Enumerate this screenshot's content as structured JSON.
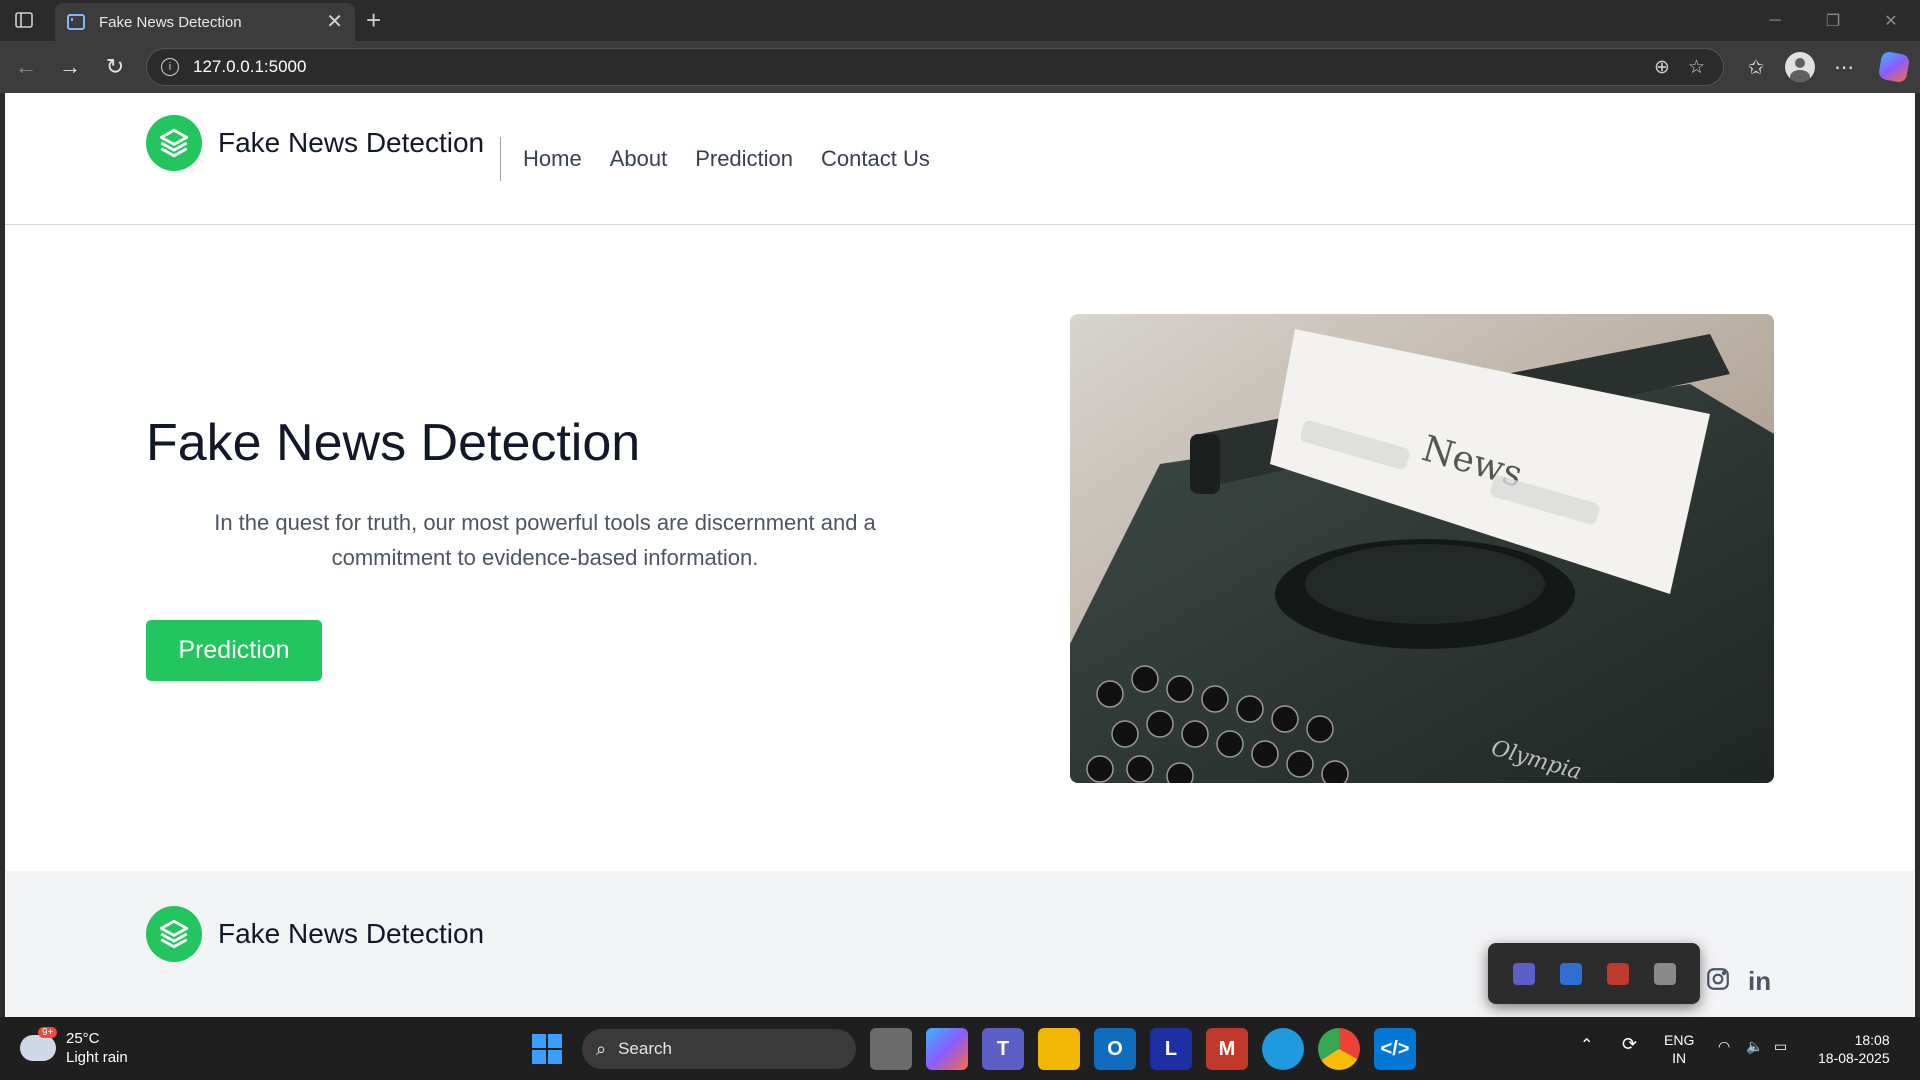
{
  "browser": {
    "tab_title": "Fake News Detection",
    "url": "127.0.0.1:5000"
  },
  "site": {
    "brand": "Fake News Detection",
    "nav": [
      "Home",
      "About",
      "Prediction",
      "Contact Us"
    ]
  },
  "hero": {
    "title": "Fake News Detection",
    "description": "In the quest for truth, our most powerful tools are discernment and a commitment to evidence-based information.",
    "button": "Prediction",
    "image_text": "News",
    "image_brand": "Olympia"
  },
  "footer": {
    "brand": "Fake News Detection",
    "social_icons": [
      "facebook-icon",
      "twitter-icon",
      "instagram-icon",
      "linkedin-icon"
    ]
  },
  "taskbar": {
    "weather_temp": "25°C",
    "weather_desc": "Light rain",
    "weather_badge": "9+",
    "search_label": "Search",
    "lang_line1": "ENG",
    "lang_line2": "IN",
    "time": "18:08",
    "date": "18-08-2025"
  },
  "colors": {
    "accent": "#22c55e",
    "text_dark": "#111827",
    "footer_bg": "#f3f4f6"
  }
}
